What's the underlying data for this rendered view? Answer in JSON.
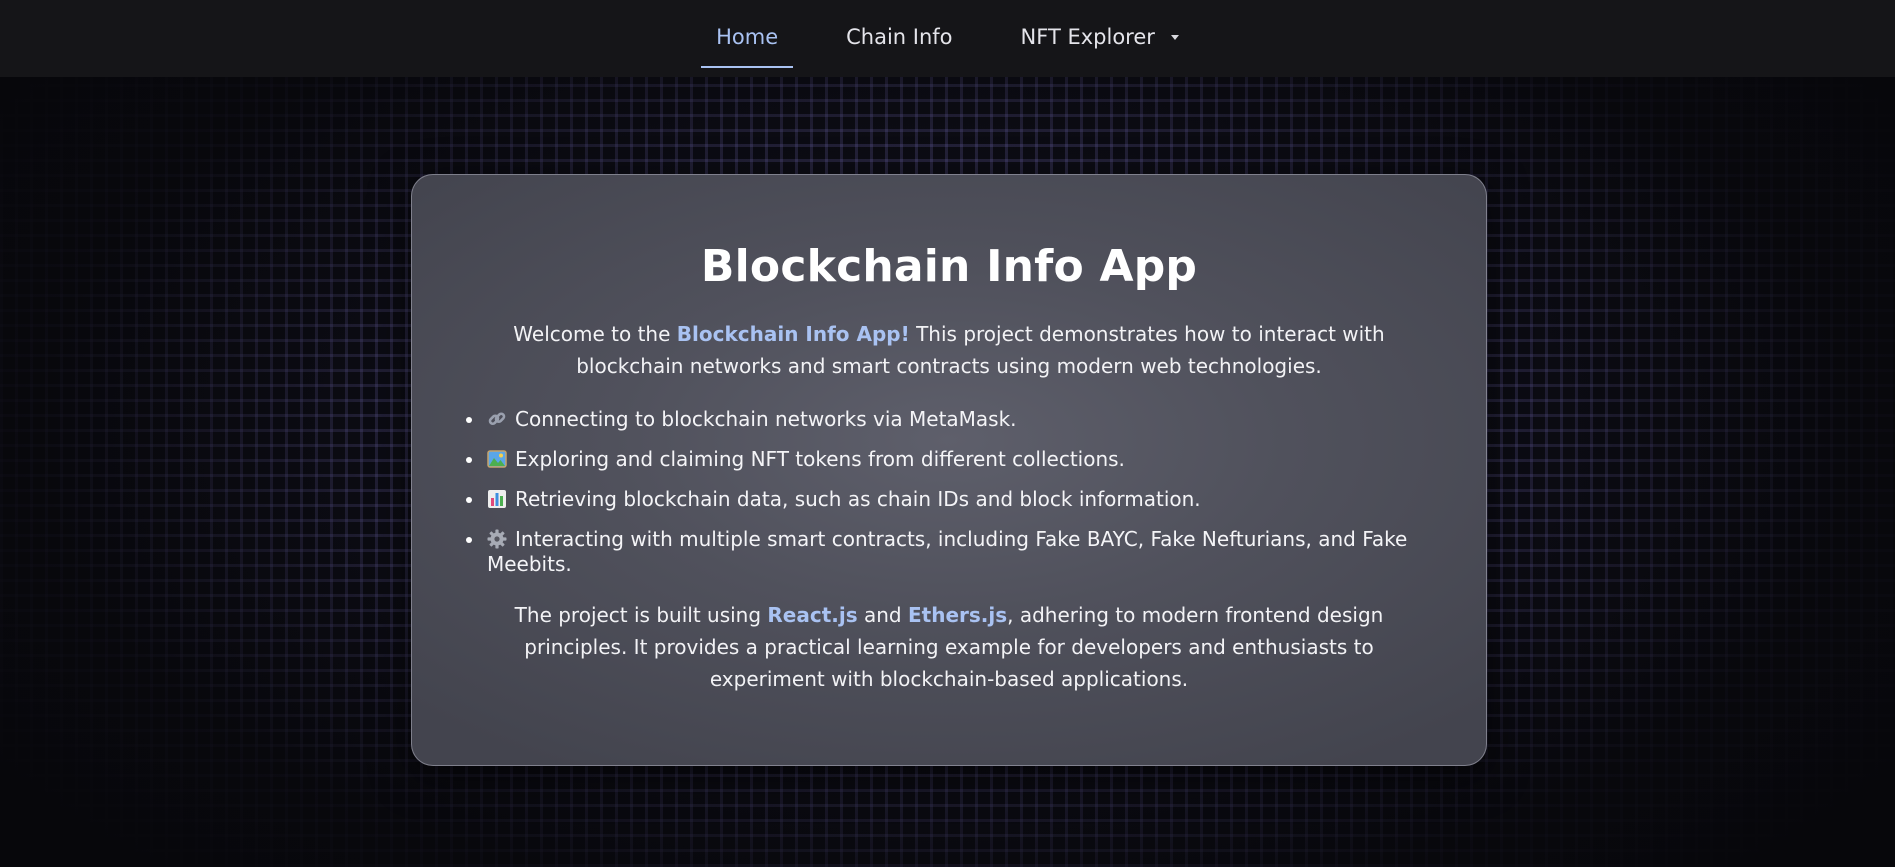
{
  "nav": {
    "items": [
      {
        "label": "Home"
      },
      {
        "label": "Chain Info"
      },
      {
        "label": "NFT Explorer"
      }
    ]
  },
  "card": {
    "title": "Blockchain Info App",
    "intro": {
      "before": "Welcome to the ",
      "highlight": "Blockchain Info App!",
      "after": " This project demonstrates how to interact with blockchain networks and smart contracts using modern web technologies."
    },
    "features": [
      {
        "icon": "link-icon",
        "text": "Connecting to blockchain networks via MetaMask."
      },
      {
        "icon": "picture-icon",
        "text": "Exploring and claiming NFT tokens from different collections."
      },
      {
        "icon": "bar-chart-icon",
        "text": "Retrieving blockchain data, such as chain IDs and block information."
      },
      {
        "icon": "gear-icon",
        "text": "Interacting with multiple smart contracts, including Fake BAYC, Fake Nefturians, and Fake Meebits."
      }
    ],
    "outro": {
      "before": "The project is built using ",
      "link1": "React.js",
      "middle": " and ",
      "link2": "Ethers.js",
      "after": ", adhering to modern frontend design principles. It provides a practical learning example for developers and enthusiasts to experiment with blockchain-based applications."
    }
  },
  "colors": {
    "accent": "#a9c2f2",
    "navbar_bg": "#151518",
    "card_bg": "#54555f",
    "page_bg": "#0c0c14"
  }
}
